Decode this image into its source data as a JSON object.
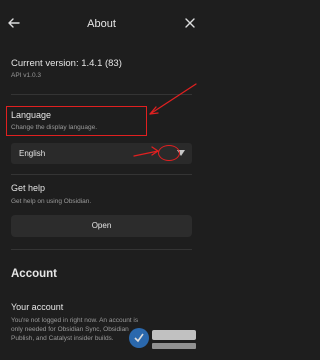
{
  "header": {
    "title": "About",
    "back_icon": "back-arrow-icon",
    "close_icon": "close-icon"
  },
  "about": {
    "version": "Current version: 1.4.1 (83)",
    "api": "API v1.0.3"
  },
  "language": {
    "title": "Language",
    "description": "Change the display language.",
    "selected": "English"
  },
  "help": {
    "title": "Get help",
    "description": "Get help on using Obsidian.",
    "button_label": "Open"
  },
  "account": {
    "heading": "Account",
    "title": "Your account",
    "lines": [
      "You're not logged in right now. An account is",
      "only needed for Obsidian Sync, Obsidian",
      "Publish, and Catalyst insider builds."
    ]
  },
  "colors": {
    "background": "#1e1e1e",
    "annotation_red": "#e02020",
    "dropdown_bg": "#2a2a2a"
  }
}
